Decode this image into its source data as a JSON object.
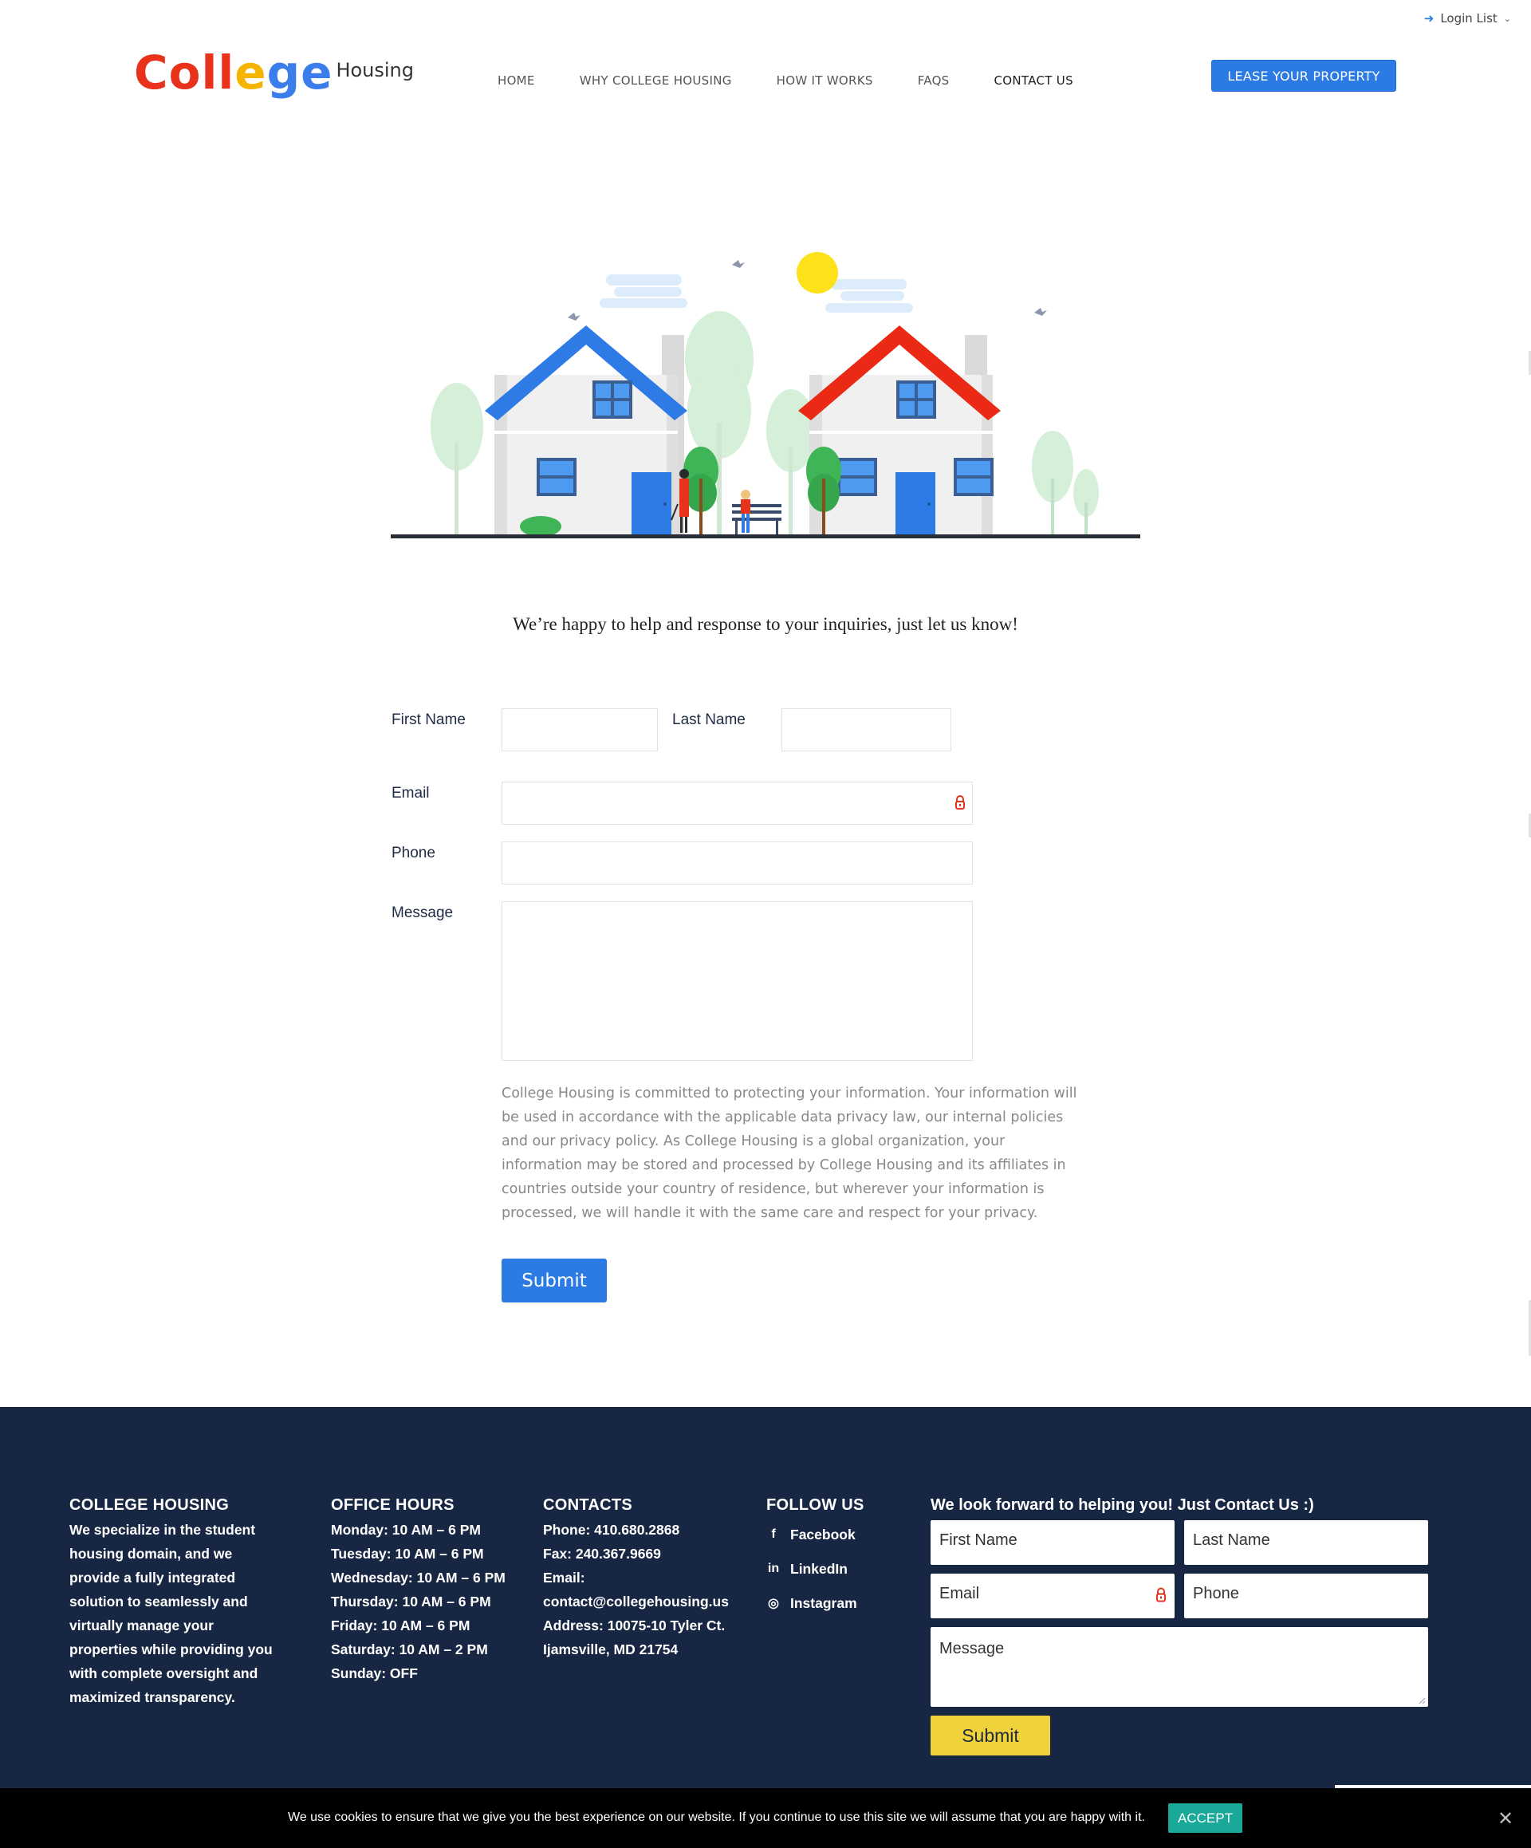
{
  "header": {
    "login_list": "Login List",
    "logo": {
      "word_letters": [
        "C",
        "o",
        "l",
        "l",
        "e",
        "g",
        "e"
      ],
      "word_colors": [
        "#e8321c",
        "#e8321c",
        "#e8321c",
        "#e8321c",
        "#f5b400",
        "#3b7dea",
        "#3b7dea"
      ],
      "sub": "Housing"
    },
    "nav": [
      "HOME",
      "WHY COLLEGE HOUSING",
      "HOW IT WORKS",
      "FAQS",
      "CONTACT US"
    ],
    "nav_active": "CONTACT US",
    "lease_button": "LEASE YOUR PROPERTY"
  },
  "intro": "We’re happy to help and response to your inquiries, just let us know!",
  "contact_form": {
    "first_name_label": "First Name",
    "last_name_label": "Last Name",
    "email_label": "Email",
    "phone_label": "Phone",
    "message_label": "Message",
    "privacy_text": "College Housing is committed to protecting your information. Your information will be used in accordance with the applicable data privacy law, our internal policies and our privacy policy. As College Housing is a global organization, your information may be stored and processed by College Housing and its affiliates in countries outside your country of residence, but wherever your information is processed, we will handle it with the same care and respect for your privacy.",
    "submit_label": "Submit"
  },
  "footer": {
    "about": {
      "heading": "COLLEGE HOUSING",
      "lines": [
        "We specialize in the student",
        "housing domain, and we",
        "provide a fully integrated",
        "solution to seamlessly and",
        "virtually manage your",
        "properties while providing you",
        "with complete oversight and",
        "maximized transparency."
      ]
    },
    "hours": {
      "heading": "OFFICE HOURS",
      "lines": [
        "Monday: 10 AM – 6 PM",
        "Tuesday: 10 AM – 6 PM",
        "Wednesday: 10 AM – 6 PM",
        "Thursday: 10 AM – 6 PM",
        "Friday: 10 AM – 6 PM",
        "Saturday: 10 AM – 2 PM",
        "Sunday: OFF"
      ]
    },
    "contacts": {
      "heading": "CONTACTS",
      "lines": [
        "Phone: 410.680.2868",
        "Fax: 240.367.9669",
        "Email:",
        "contact@collegehousing.us",
        "Address: 10075-10 Tyler Ct.",
        "Ijamsville, MD 21754"
      ]
    },
    "follow": {
      "heading": "FOLLOW US",
      "items": [
        {
          "label": "Facebook",
          "icon": "facebook-icon",
          "glyph": "f"
        },
        {
          "label": "LinkedIn",
          "icon": "linkedin-icon",
          "glyph": "in"
        },
        {
          "label": "Instagram",
          "icon": "instagram-icon",
          "glyph": "◎"
        }
      ]
    },
    "form": {
      "title": "We look forward to helping you! Just Contact Us :)",
      "first_name_placeholder": "First Name",
      "last_name_placeholder": "Last Name",
      "email_placeholder": "Email",
      "phone_placeholder": "Phone",
      "message_placeholder": "Message",
      "submit_label": "Submit"
    }
  },
  "cookie": {
    "text": "We use cookies to ensure that we give you the best experience on our website. If you continue to use this site we will assume that you are happy with it.",
    "accept": "ACCEPT",
    "close": "✕"
  },
  "colors": {
    "accent_blue": "#2c7be5",
    "footer_bg": "#172743",
    "footer_submit": "#f0d33a",
    "cookie_accept": "#1aa898",
    "house_left_roof": "#2f7be6",
    "house_right_roof": "#ea2a14"
  }
}
